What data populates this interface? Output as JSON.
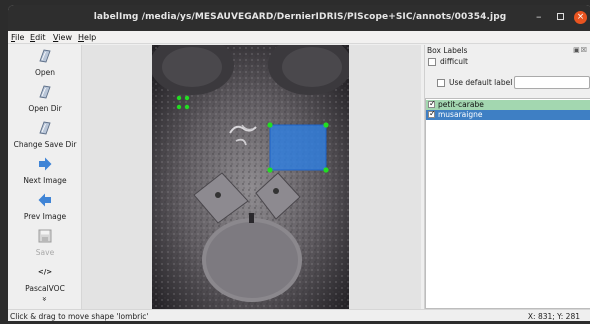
{
  "window": {
    "title": "labelImg /media/ys/MESAUVEGARD/DernierIDRIS/PIScope+SIC/annots/00354.jpg",
    "minimize_glyph": "–",
    "close_glyph": "×"
  },
  "menu": [
    "File",
    "Edit",
    "View",
    "Help"
  ],
  "toolbar": {
    "open": "Open",
    "open_dir": "Open Dir",
    "change_save_dir": "Change Save Dir",
    "next_image": "Next Image",
    "prev_image": "Prev Image",
    "save": "Save",
    "format_icon_text": "</>",
    "format": "PascalVOC",
    "more": "»"
  },
  "dock": {
    "title": "Box Labels",
    "buttons": "▣☒",
    "difficult": "difficult",
    "use_default_label": "Use default label",
    "default_label_value": "",
    "labels": [
      {
        "name": "petit-carabe",
        "checked": true,
        "color": "#a3d7b0",
        "text_color": "#111111"
      },
      {
        "name": "musaraigne",
        "checked": true,
        "color": "#3e7fc4",
        "text_color": "#ffffff"
      }
    ]
  },
  "status": {
    "message": "Click & drag to move shape 'lombric'",
    "coords": "X: 831; Y: 281"
  },
  "colors": {
    "accent": "#e95420",
    "selected_box": "#2f7fe0",
    "handle": "#22dd22"
  },
  "icons": {
    "open": "folder-open-icon",
    "open_dir": "folder-open-icon",
    "change_save_dir": "folder-open-icon",
    "next_image": "arrow-right-icon",
    "prev_image": "arrow-left-icon",
    "save": "floppy-disk-icon",
    "format": "code-icon",
    "more": "chevron-double-down-icon"
  }
}
